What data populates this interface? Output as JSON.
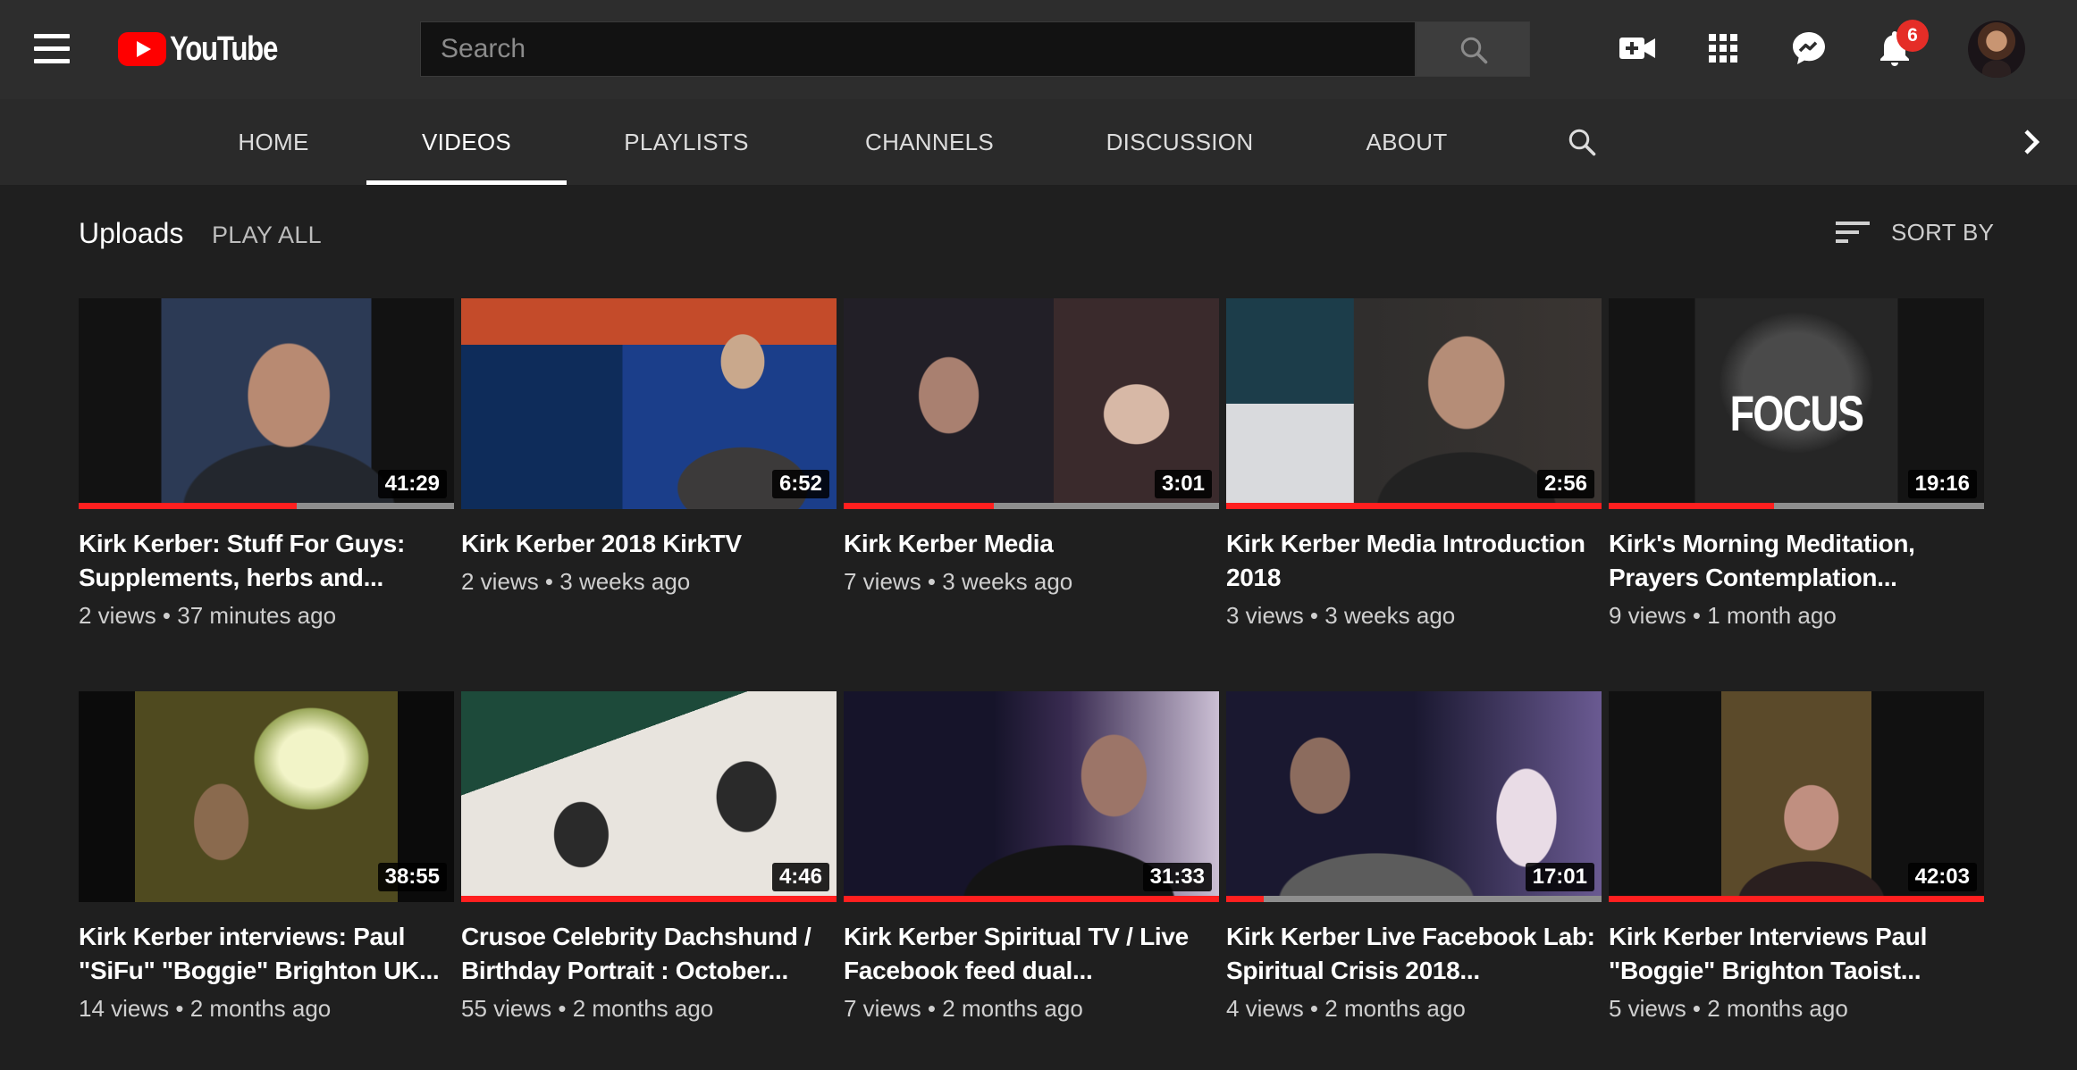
{
  "app": {
    "logo_text": "YouTube",
    "search_placeholder": "Search",
    "notification_count": "6"
  },
  "tabs": [
    {
      "label": "HOME",
      "active": false
    },
    {
      "label": "VIDEOS",
      "active": true
    },
    {
      "label": "PLAYLISTS",
      "active": false
    },
    {
      "label": "CHANNELS",
      "active": false
    },
    {
      "label": "DISCUSSION",
      "active": false
    },
    {
      "label": "ABOUT",
      "active": false
    }
  ],
  "uploads": {
    "title": "Uploads",
    "play_all": "PLAY ALL",
    "sort_by": "SORT BY"
  },
  "videos": [
    {
      "title": "Kirk Kerber: Stuff For Guys: Supplements, herbs and...",
      "views": "2 views",
      "age": "37 minutes ago",
      "duration": "41:29",
      "watched": 0.58
    },
    {
      "title": "Kirk Kerber 2018 KirkTV",
      "views": "2 views",
      "age": "3 weeks ago",
      "duration": "6:52",
      "watched": 0
    },
    {
      "title": "Kirk Kerber Media",
      "views": "7 views",
      "age": "3 weeks ago",
      "duration": "3:01",
      "watched": 0.4
    },
    {
      "title": "Kirk Kerber Media Introduction 2018",
      "views": "3 views",
      "age": "3 weeks ago",
      "duration": "2:56",
      "watched": 1.0
    },
    {
      "title": "Kirk's Morning Meditation, Prayers Contemplation...",
      "views": "9 views",
      "age": "1 month ago",
      "duration": "19:16",
      "watched": 0.44
    },
    {
      "title": "Kirk Kerber interviews: Paul \"SiFu\" \"Boggie\" Brighton UK...",
      "views": "14 views",
      "age": "2 months ago",
      "duration": "38:55",
      "watched": 0
    },
    {
      "title": "Crusoe Celebrity Dachshund / Birthday Portrait : October...",
      "views": "55 views",
      "age": "2 months ago",
      "duration": "4:46",
      "watched": 1.0
    },
    {
      "title": "Kirk Kerber Spiritual TV / Live Facebook feed dual...",
      "views": "7 views",
      "age": "2 months ago",
      "duration": "31:33",
      "watched": 1.0
    },
    {
      "title": "Kirk Kerber Live Facebook Lab: Spiritual Crisis 2018...",
      "views": "4 views",
      "age": "2 months ago",
      "duration": "17:01",
      "watched": 0.1
    },
    {
      "title": "Kirk Kerber Interviews Paul \"Boggie\" Brighton Taoist...",
      "views": "5 views",
      "age": "2 months ago",
      "duration": "42:03",
      "watched": 1.0
    }
  ],
  "colors": {
    "masthead": "#2d2d2d",
    "background": "#1f1f1f",
    "progress": "#ff1f1f",
    "badge": "#e52d27"
  }
}
